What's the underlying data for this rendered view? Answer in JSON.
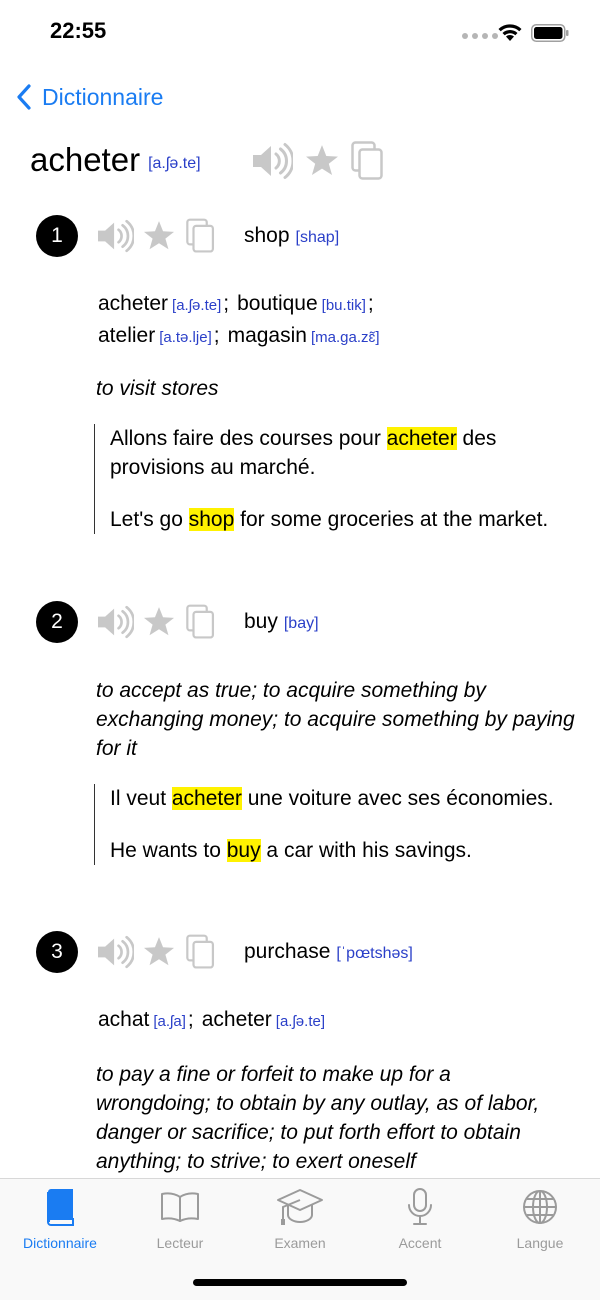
{
  "status": {
    "time": "22:55"
  },
  "nav": {
    "back_label": "Dictionnaire"
  },
  "entry": {
    "word": "acheter",
    "ipa": "[a.ʃə.te]"
  },
  "colors": {
    "accent": "#1a7cf2",
    "ipa": "#2a3fc8",
    "highlight": "#fff200",
    "inactive_icon": "#c8c8c8"
  },
  "senses": [
    {
      "number": "1",
      "word": "shop",
      "ipa": "[shap]",
      "synonyms": [
        {
          "word": "acheter",
          "ipa": "[a.ʃə.te]"
        },
        {
          "word": "boutique",
          "ipa": "[bu.tik]"
        },
        {
          "word": "atelier",
          "ipa": "[a.tə.lje]"
        },
        {
          "word": "magasin",
          "ipa": "[ma.ga.zɛ̃]"
        }
      ],
      "definition": "to visit stores",
      "example_fr": {
        "before": "Allons faire des courses pour ",
        "highlight": "acheter",
        "after": " des provisions au marché."
      },
      "example_en": {
        "before": "Let's go ",
        "highlight": "shop",
        "after": " for some groceries at the market."
      }
    },
    {
      "number": "2",
      "word": "buy",
      "ipa": "[bay]",
      "definition": "to accept as true; to acquire something by exchanging money; to acquire something by paying for it",
      "example_fr": {
        "before": "Il veut ",
        "highlight": "acheter",
        "after": " une voiture avec ses économies."
      },
      "example_en": {
        "before": "He wants to ",
        "highlight": "buy",
        "after": " a car with his savings."
      }
    },
    {
      "number": "3",
      "word": "purchase",
      "ipa": "[ˈpœtshəs]",
      "synonyms": [
        {
          "word": "achat",
          "ipa": "[a.ʃa]"
        },
        {
          "word": "acheter",
          "ipa": "[a.ʃə.te]"
        }
      ],
      "definition": "to pay a fine or forfeit to make up for a wrongdoing; to obtain by any outlay, as of labor, danger or sacrifice; to put forth effort to obtain anything; to strive; to exert oneself"
    }
  ],
  "tabs": [
    {
      "label": "Dictionnaire",
      "icon": "book-icon",
      "active": true
    },
    {
      "label": "Lecteur",
      "icon": "open-book-icon",
      "active": false
    },
    {
      "label": "Examen",
      "icon": "graduation-cap-icon",
      "active": false
    },
    {
      "label": "Accent",
      "icon": "microphone-icon",
      "active": false
    },
    {
      "label": "Langue",
      "icon": "globe-icon",
      "active": false
    }
  ]
}
